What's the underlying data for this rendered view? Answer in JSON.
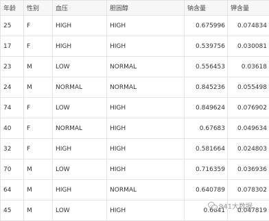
{
  "table": {
    "headers": [
      "年龄",
      "性别",
      "血压",
      "胆固醇",
      "钠含量",
      "钾含量"
    ],
    "rows": [
      [
        "25",
        "F",
        "HIGH",
        "HIGH",
        "0.675996",
        "0.074834"
      ],
      [
        "17",
        "F",
        "HIGH",
        "HIGH",
        "0.539756",
        "0.030081"
      ],
      [
        "23",
        "M",
        "LOW",
        "NORMAL",
        "0.556453",
        "0.03618"
      ],
      [
        "24",
        "M",
        "NORMAL",
        "NORMAL",
        "0.845236",
        "0.055498"
      ],
      [
        "74",
        "F",
        "LOW",
        "HIGH",
        "0.849624",
        "0.076902"
      ],
      [
        "40",
        "F",
        "NORMAL",
        "HIGH",
        "0.67683",
        "0.049634"
      ],
      [
        "32",
        "F",
        "HIGH",
        "HIGH",
        "0.581664",
        "0.024803"
      ],
      [
        "70",
        "M",
        "LOW",
        "HIGH",
        "0.716359",
        "0.036936"
      ],
      [
        "64",
        "M",
        "HIGH",
        "NORMAL",
        "0.640789",
        "0.078302"
      ],
      [
        "45",
        "M",
        "LOW",
        "HIGH",
        "0.6641",
        "0.047819"
      ]
    ]
  },
  "watermark": {
    "text": "941大数据",
    "icon": "wechat-icon"
  }
}
